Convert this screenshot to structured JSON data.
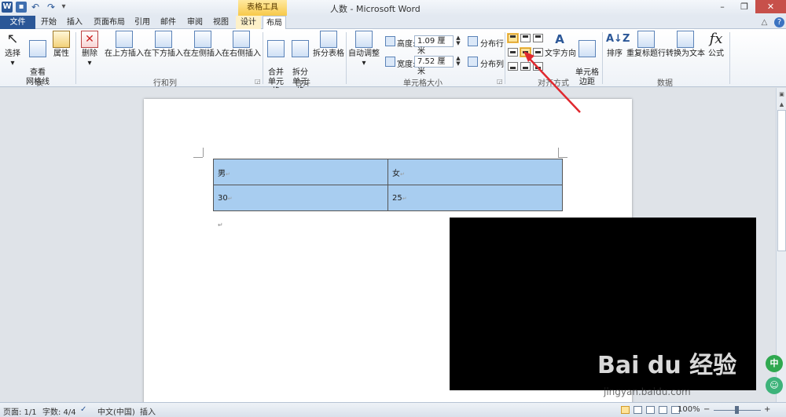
{
  "titlebar": {
    "title": "人数 - Microsoft Word",
    "table_tools": "表格工具",
    "word_logo": "W",
    "undo": "↶",
    "redo": "↷",
    "more": "▾",
    "minimize": "–",
    "maximize": "❐",
    "close": "✕"
  },
  "tabs": [
    "文件",
    "开始",
    "插入",
    "页面布局",
    "引用",
    "邮件",
    "审阅",
    "视图",
    "设计",
    "布局"
  ],
  "tab_help": "?",
  "tab_min": "△",
  "ribbon": {
    "table_group": {
      "label": "表",
      "select": "选择",
      "select_arrow": "▾",
      "gridlines": "查看\n网格线",
      "properties": "属性"
    },
    "rows_cols_group": {
      "label": "行和列",
      "delete": "删除",
      "delete_arrow": "▾",
      "insert_above": "在上方插入",
      "insert_below": "在下方插入",
      "insert_left": "在左侧插入",
      "insert_right": "在右侧插入"
    },
    "merge_group": {
      "label": "合并",
      "merge_cells": "合并\n单元格",
      "split_cells": "拆分\n单元格",
      "split_table": "拆分表格"
    },
    "cell_size_group": {
      "label": "单元格大小",
      "autofit": "自动调整",
      "autofit_arrow": "▾",
      "height_label": "高度:",
      "height_value": "1.09 厘米",
      "width_label": "宽度:",
      "width_value": "7.52 厘米",
      "distribute_rows": "分布行",
      "distribute_cols": "分布列"
    },
    "alignment_group": {
      "label": "对齐方式",
      "text_direction": "文字方向",
      "cell_margins": "单元格\n边距"
    },
    "data_group": {
      "label": "数据",
      "sort": "排序",
      "sort_glyph": "A↓Z",
      "repeat_header": "重复标题行",
      "convert_text": "转换为文本",
      "formula": "公式",
      "formula_glyph": "fx"
    },
    "text_direction_glyph": "A",
    "select_glyph": "↖"
  },
  "table": {
    "rows": [
      [
        "男",
        "女"
      ],
      [
        "30",
        "25"
      ]
    ],
    "para_mark": "↵"
  },
  "watermark": {
    "brand": "Bai du 经验",
    "url": "jingyan.baidu.com"
  },
  "side_badges": [
    "中",
    "☺"
  ],
  "statusbar": {
    "page": "页面: 1/1",
    "words": "字数: 4/4",
    "language": "中文(中国)",
    "mode": "插入",
    "zoom": "100%",
    "zoom_minus": "−",
    "zoom_plus": "+"
  },
  "colors": {
    "accent": "#2b5797",
    "cell_fill": "#a8cdf0",
    "arrow": "#e0282e",
    "tools_tab": "#f7c94a"
  }
}
